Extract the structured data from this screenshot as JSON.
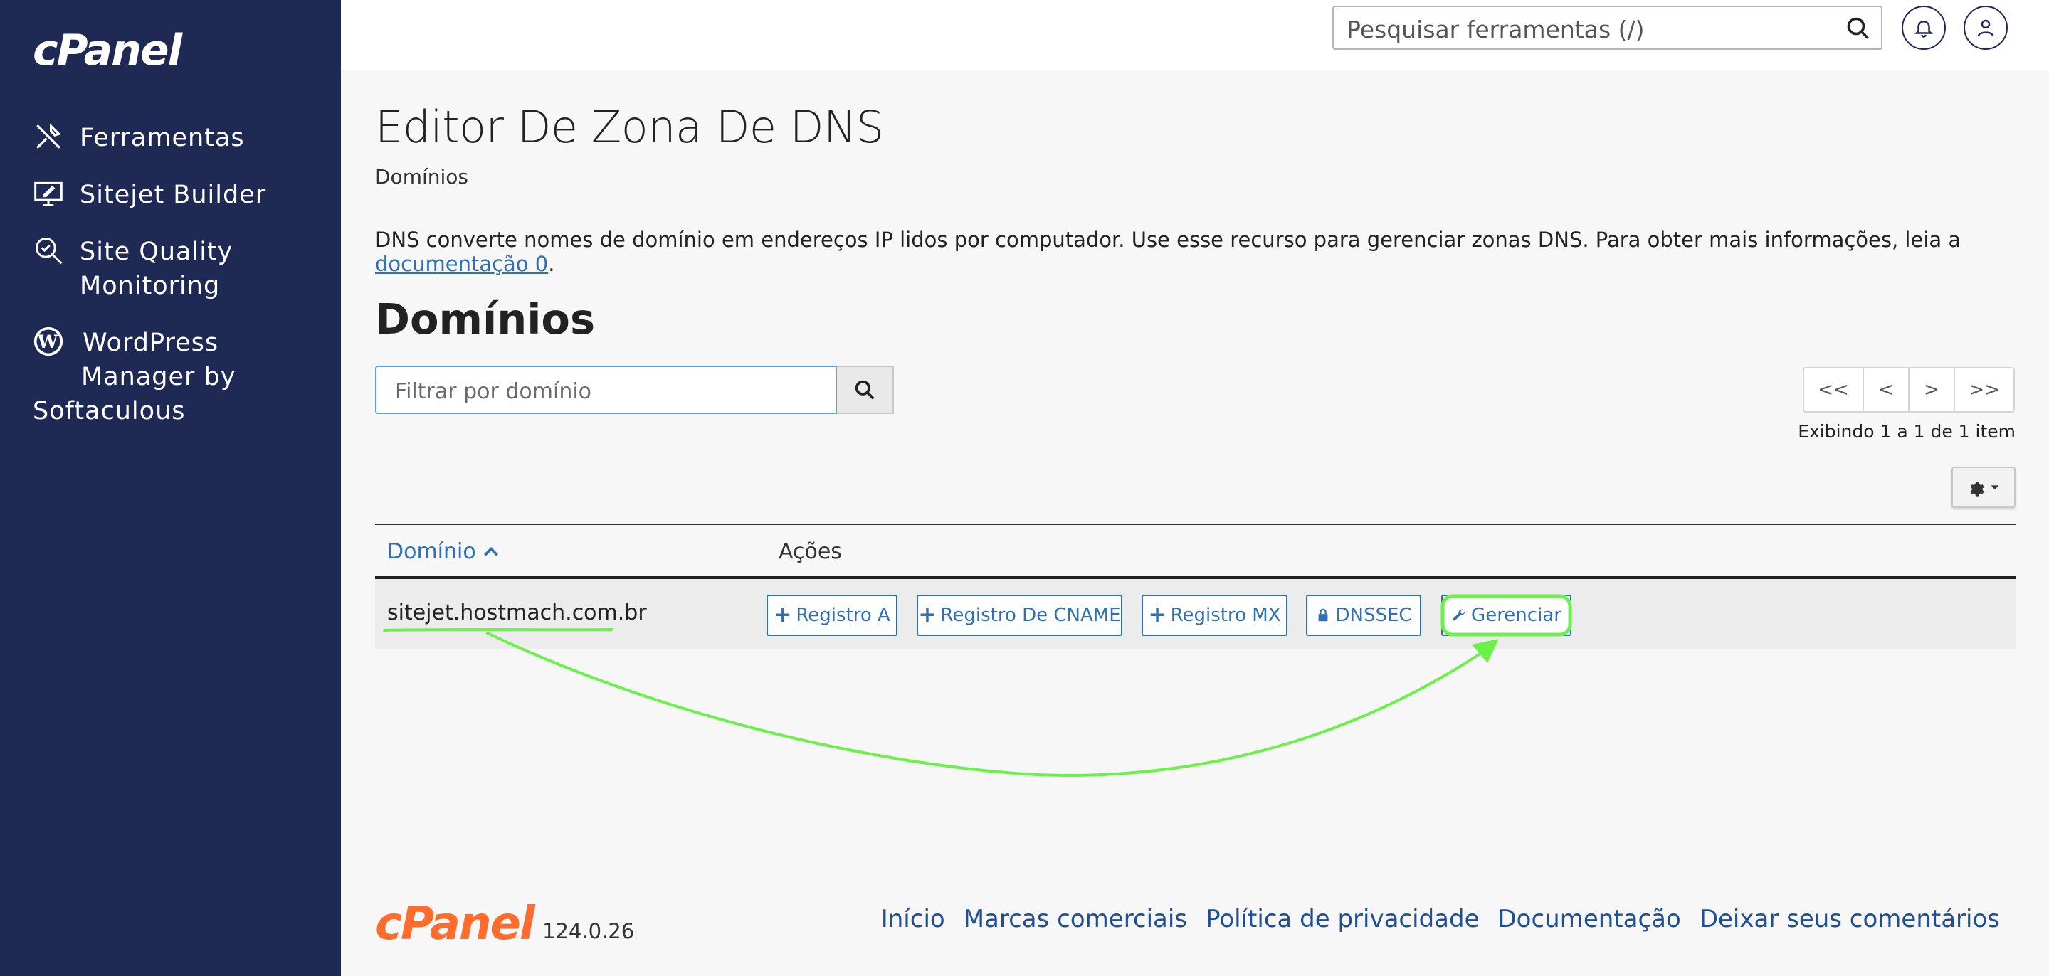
{
  "sidebar": {
    "logo": "cPanel",
    "items": [
      {
        "label": "Ferramentas",
        "icon": "tools-icon"
      },
      {
        "label": "Sitejet Builder",
        "icon": "monitor-pen-icon"
      },
      {
        "label_line1": "Site Quality",
        "label_line2": "Monitoring",
        "icon": "magnifier-check-icon"
      },
      {
        "label_line1": "WordPress",
        "label_line2": "Manager by",
        "label_line3": "Softaculous",
        "icon": "wordpress-icon"
      }
    ]
  },
  "header": {
    "search_placeholder": "Pesquisar ferramentas (/)",
    "notifications_icon": "bell-icon",
    "user_icon": "user-icon"
  },
  "main": {
    "title": "Editor De Zona De DNS",
    "breadcrumb": "Domínios",
    "description_text": "DNS converte nomes de domínio em endereços IP lidos por computador. Use esse recurso para gerenciar zonas DNS. Para obter mais informações, leia a ",
    "description_link": "documentação 0",
    "description_end": ".",
    "section_title": "Domínios",
    "filter_placeholder": "Filtrar por domínio",
    "pager": {
      "first": "<<",
      "prev": "<",
      "next": ">",
      "last": ">>"
    },
    "showing": "Exibindo 1 a 1 de 1 item",
    "table": {
      "col_domain": "Domínio",
      "col_actions": "Ações",
      "rows": [
        {
          "domain": "sitejet.hostmach.com.br",
          "actions": {
            "a_record": "Registro A",
            "cname_record": "Registro De CNAME",
            "mx_record": "Registro MX",
            "dnssec": "DNSSEC",
            "manage": "Gerenciar"
          }
        }
      ]
    }
  },
  "annotation": {
    "color": "#6cf14a"
  },
  "footer": {
    "logo": "cPanel",
    "version": "124.0.26",
    "links": [
      "Início",
      "Marcas comerciais",
      "Política de privacidade",
      "Documentação",
      "Deixar seus comentários"
    ]
  }
}
